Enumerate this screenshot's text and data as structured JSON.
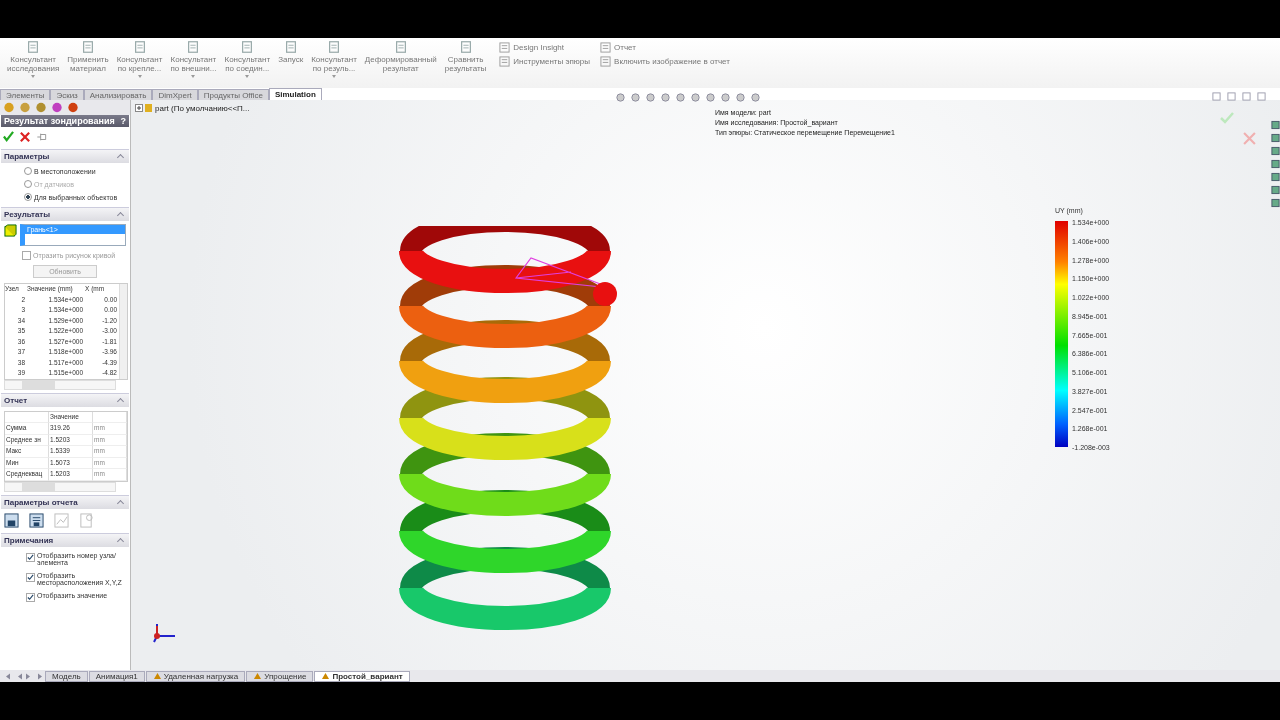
{
  "ribbon": {
    "buttons": [
      {
        "lines": [
          "Консультант",
          "исследования"
        ],
        "dropdown": true
      },
      {
        "lines": [
          "Применить",
          "материал"
        ],
        "dropdown": false
      },
      {
        "lines": [
          "Консультант",
          "по крепле..."
        ],
        "dropdown": true
      },
      {
        "lines": [
          "Консультант",
          "по внешни..."
        ],
        "dropdown": true
      },
      {
        "lines": [
          "Консультант",
          "по соедин..."
        ],
        "dropdown": true
      },
      {
        "lines": [
          "Запуск"
        ],
        "dropdown": false
      },
      {
        "lines": [
          "Консультант",
          "по резуль..."
        ],
        "dropdown": true
      },
      {
        "lines": [
          "Деформированный",
          "результат"
        ],
        "dropdown": false
      },
      {
        "lines": [
          "Сравнить",
          "результаты"
        ],
        "dropdown": false
      }
    ],
    "small_columns": [
      [
        "Design Insight",
        "Инструменты эпюры"
      ],
      [
        "Отчет",
        "Включить изображение в отчет"
      ]
    ]
  },
  "command_tabs": [
    {
      "label": "Элементы",
      "selected": false
    },
    {
      "label": "Эскиз",
      "selected": false
    },
    {
      "label": "Анализировать",
      "selected": false
    },
    {
      "label": "DimXpert",
      "selected": false
    },
    {
      "label": "Продукты Office",
      "selected": false
    },
    {
      "label": "Simulation",
      "selected": true
    }
  ],
  "panel": {
    "title": "Результат зондирования",
    "help": "?",
    "options": {
      "title": "Параметры",
      "items": [
        {
          "label": "В местоположении",
          "selected": false,
          "disabled": false
        },
        {
          "label": "От датчиков",
          "selected": false,
          "disabled": true
        },
        {
          "label": "Для выбранных объектов",
          "selected": true,
          "disabled": false
        }
      ]
    },
    "results": {
      "title": "Результаты",
      "selection": "Грань<1>",
      "checkbox": {
        "label": "Отразить рисунок кривой",
        "checked": false
      },
      "button": "Обновить",
      "columns": [
        "Узел",
        "Значение (mm)",
        "X (mm"
      ],
      "rows": [
        [
          "2",
          "1.534e+000",
          "0.00"
        ],
        [
          "3",
          "1.534e+000",
          "0.00"
        ],
        [
          "34",
          "1.529e+000",
          "-1.20"
        ],
        [
          "35",
          "1.522e+000",
          "-3.00"
        ],
        [
          "36",
          "1.527e+000",
          "-1.81"
        ],
        [
          "37",
          "1.518e+000",
          "-3.96"
        ],
        [
          "38",
          "1.517e+000",
          "-4.39"
        ],
        [
          "39",
          "1.515e+000",
          "-4.82"
        ]
      ]
    },
    "report": {
      "title": "Отчет",
      "header": "Значение",
      "rows": [
        [
          "Сумма",
          "319.26",
          "mm"
        ],
        [
          "Среднее зн",
          "1.5203",
          "mm"
        ],
        [
          "Макс",
          "1.5339",
          "mm"
        ],
        [
          "Мин",
          "1.5073",
          "mm"
        ],
        [
          "Среднеквац",
          "1.5203",
          "mm"
        ]
      ]
    },
    "report_options": {
      "title": "Параметры отчета"
    },
    "notes": {
      "title": "Примечания",
      "items": [
        {
          "label": "Отобразить номер узла/элемента",
          "checked": true
        },
        {
          "label": "Отобразить месторасположения X,Y,Z",
          "checked": true
        },
        {
          "label": "Отобразить значение",
          "checked": true
        }
      ]
    }
  },
  "viewport": {
    "tree_item": "part  (По умолчанию<<П...",
    "info": [
      "Имя модели: part",
      "Имя  исследования: Простой_вариант",
      "Тип эпюры: Статическое перемещение Перемещение1"
    ],
    "legend": {
      "title": "UY (mm)",
      "labels": [
        "1.534e+000",
        "1.406e+000",
        "1.278e+000",
        "1.150e+000",
        "1.022e+000",
        "8.945e-001",
        "7.665e-001",
        "6.386e-001",
        "5.106e-001",
        "3.827e-001",
        "2.547e-001",
        "1.268e-001",
        "-1.208e-003"
      ]
    }
  },
  "bottom_tabs": [
    {
      "label": "Модель",
      "selected": false
    },
    {
      "label": "Анимация1",
      "selected": false
    },
    {
      "label": "Удаленная нагрузка",
      "selected": false
    },
    {
      "label": "Упрощение",
      "selected": false
    },
    {
      "label": "Простой_вариант",
      "selected": true
    }
  ]
}
